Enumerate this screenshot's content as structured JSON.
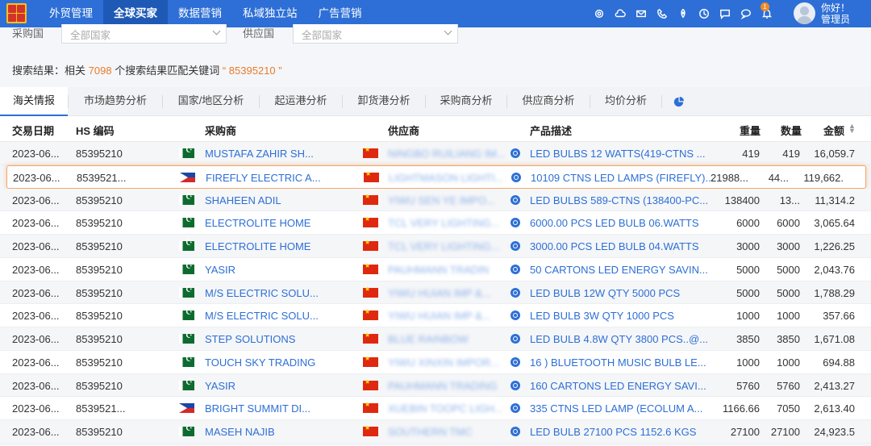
{
  "nav": {
    "tabs": [
      "外贸管理",
      "全球买家",
      "数据营销",
      "私域独立站",
      "广告营销"
    ],
    "active_tab": "全球买家",
    "icons": [
      "settings-icon",
      "cloud-icon",
      "mail-icon",
      "phone-icon",
      "rocket-icon",
      "clock-icon",
      "chat-icon",
      "message-icon",
      "bell-icon"
    ],
    "bell_badge": "1",
    "greeting": "你好！",
    "role": "管理员"
  },
  "filters": {
    "buyer_country_label": "采购国",
    "buyer_country_value": "全部国家",
    "supplier_country_label": "供应国",
    "supplier_country_value": "全部国家"
  },
  "summary": {
    "prefix": "搜索结果：相关",
    "count": "7098",
    "middle": "个搜索结果匹配关键词",
    "keyword": "“ 85395210 ”"
  },
  "tabs": [
    "海关情报",
    "市场趋势分析",
    "国家/地区分析",
    "起运港分析",
    "卸货港分析",
    "采购商分析",
    "供应商分析",
    "均价分析"
  ],
  "table": {
    "headers": {
      "date": "交易日期",
      "hs": "HS 编码",
      "buyer": "采购商",
      "supplier": "供应商",
      "product": "产品描述",
      "weight": "重量",
      "qty": "数量",
      "amount": "金额"
    },
    "rows": [
      {
        "date": "2023-06...",
        "hs": "85395210",
        "buyer_flag": "pk",
        "buyer": "MUSTAFA ZAHIR SH...",
        "supplier": "NINGBO RUILIANG IM...",
        "product": "LED BULBS 12 WATTS(419-CTNS ...",
        "weight": "419",
        "qty": "419",
        "amount": "16,059.7"
      },
      {
        "date": "2023-06...",
        "hs": "8539521...",
        "buyer_flag": "ph",
        "buyer": "FIREFLY ELECTRIC A...",
        "supplier": "LIGHTMASON LIGHTI...",
        "product": "10109 CTNS LED LAMPS (FIREFLY)...",
        "weight": "21988...",
        "qty": "44...",
        "amount": "119,662."
      },
      {
        "date": "2023-06...",
        "hs": "85395210",
        "buyer_flag": "pk",
        "buyer": "SHAHEEN ADIL",
        "supplier": "YIWU SEN YE IMPO...",
        "product": "LED BULBS 589-CTNS (138400-PC...",
        "weight": "138400",
        "qty": "13...",
        "amount": "11,314.2"
      },
      {
        "date": "2023-06...",
        "hs": "85395210",
        "buyer_flag": "pk",
        "buyer": "ELECTROLITE HOME",
        "supplier": "TCL VERY LIGHTING...",
        "product": "6000.00 PCS LED BULB 06.WATTS",
        "weight": "6000",
        "qty": "6000",
        "amount": "3,065.64"
      },
      {
        "date": "2023-06...",
        "hs": "85395210",
        "buyer_flag": "pk",
        "buyer": "ELECTROLITE HOME",
        "supplier": "TCL VERY LIGHTING...",
        "product": "3000.00 PCS LED BULB 04.WATTS",
        "weight": "3000",
        "qty": "3000",
        "amount": "1,226.25"
      },
      {
        "date": "2023-06...",
        "hs": "85395210",
        "buyer_flag": "pk",
        "buyer": "YASIR",
        "supplier": "PAUHMANN TRADIN",
        "product": "50 CARTONS LED ENERGY SAVIN...",
        "weight": "5000",
        "qty": "5000",
        "amount": "2,043.76"
      },
      {
        "date": "2023-06...",
        "hs": "85395210",
        "buyer_flag": "pk",
        "buyer": "M/S ELECTRIC SOLU...",
        "supplier": "YIWU HUIAN IMP &...",
        "product": "LED BULB 12W QTY 5000 PCS",
        "weight": "5000",
        "qty": "5000",
        "amount": "1,788.29"
      },
      {
        "date": "2023-06...",
        "hs": "85395210",
        "buyer_flag": "pk",
        "buyer": "M/S ELECTRIC SOLU...",
        "supplier": "YIWU HUIAN IMP &...",
        "product": "LED BULB 3W QTY 1000 PCS",
        "weight": "1000",
        "qty": "1000",
        "amount": "357.66"
      },
      {
        "date": "2023-06...",
        "hs": "85395210",
        "buyer_flag": "pk",
        "buyer": "STEP SOLUTIONS",
        "supplier": "BLUE RAINBOW",
        "product": "LED BULB 4.8W QTY 3800 PCS..@...",
        "weight": "3850",
        "qty": "3850",
        "amount": "1,671.08"
      },
      {
        "date": "2023-06...",
        "hs": "85395210",
        "buyer_flag": "pk",
        "buyer": "TOUCH SKY TRADING",
        "supplier": "YIWU XINXIN IMPOR...",
        "product": "16 ) BLUETOOTH MUSIC BULB LE...",
        "weight": "1000",
        "qty": "1000",
        "amount": "694.88"
      },
      {
        "date": "2023-06...",
        "hs": "85395210",
        "buyer_flag": "pk",
        "buyer": "YASIR",
        "supplier": "PAUHMANN TRADING",
        "product": "160 CARTONS LED ENERGY SAVI...",
        "weight": "5760",
        "qty": "5760",
        "amount": "2,413.27"
      },
      {
        "date": "2023-06...",
        "hs": "8539521...",
        "buyer_flag": "ph",
        "buyer": "BRIGHT SUMMIT DI...",
        "supplier": "XUEBIN TOOPC LIGH...",
        "product": "335 CTNS LED LAMP (ECOLUM A...",
        "weight": "1166.66",
        "qty": "7050",
        "amount": "2,613.40"
      },
      {
        "date": "2023-06...",
        "hs": "85395210",
        "buyer_flag": "pk",
        "buyer": "MASEH NAJIB",
        "supplier": "SOUTHERN TMC",
        "product": "LED BULB 27100 PCS 1152.6 KGS",
        "weight": "27100",
        "qty": "27100",
        "amount": "24,923.5"
      }
    ]
  }
}
